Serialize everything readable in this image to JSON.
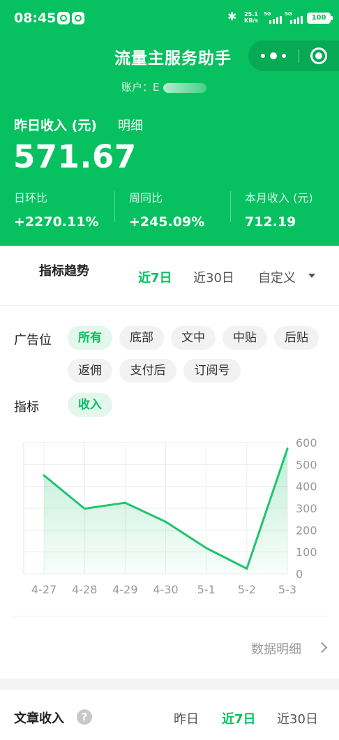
{
  "status_bar": {
    "time": "08:45",
    "net_speed": "25.1",
    "net_speed_unit": "KB/s",
    "network_1": "5G",
    "network_2": "5G",
    "battery": "100"
  },
  "header": {
    "title": "流量主服务助手",
    "account_label": "账户：E"
  },
  "summary": {
    "yesterday_label": "昨日收入 (元)",
    "detail_link": "明细",
    "yesterday_value": "571.67",
    "stats": [
      {
        "label": "日环比",
        "value": "+2270.11%"
      },
      {
        "label": "周同比",
        "value": "+245.09%"
      },
      {
        "label": "本月收入 (元)",
        "value": "712.19"
      }
    ]
  },
  "trend": {
    "title": "指标趋势",
    "tabs": [
      {
        "label": "近7日",
        "active": true
      },
      {
        "label": "近30日",
        "active": false
      },
      {
        "label": "自定义",
        "active": false
      }
    ],
    "ad_position_label": "广告位",
    "ad_positions": [
      {
        "label": "所有",
        "active": true
      },
      {
        "label": "底部",
        "active": false
      },
      {
        "label": "文中",
        "active": false
      },
      {
        "label": "中贴",
        "active": false
      },
      {
        "label": "后贴",
        "active": false
      },
      {
        "label": "返佣",
        "active": false
      },
      {
        "label": "支付后",
        "active": false
      },
      {
        "label": "订阅号",
        "active": false
      }
    ],
    "metric_label": "指标",
    "metrics": [
      {
        "label": "收入",
        "active": true
      }
    ],
    "data_detail_link": "数据明细"
  },
  "chart_data": {
    "type": "area",
    "categories": [
      "4-27",
      "4-28",
      "4-29",
      "4-30",
      "5-1",
      "5-2",
      "5-3"
    ],
    "values": [
      450,
      298,
      325,
      238,
      118,
      24,
      572
    ],
    "ylim": [
      0,
      600
    ],
    "yticks": [
      0,
      100,
      200,
      300,
      400,
      500,
      600
    ],
    "grid": true,
    "y_axis_side": "right",
    "color": "#1fc46f"
  },
  "article_income": {
    "title": "文章收入",
    "help_icon": "?",
    "tabs": [
      {
        "label": "昨日",
        "active": false
      },
      {
        "label": "近7日",
        "active": true
      },
      {
        "label": "近30日",
        "active": false
      }
    ]
  },
  "colors": {
    "brand_green": "#07c160",
    "active_chip_bg": "#e3f7ec"
  }
}
